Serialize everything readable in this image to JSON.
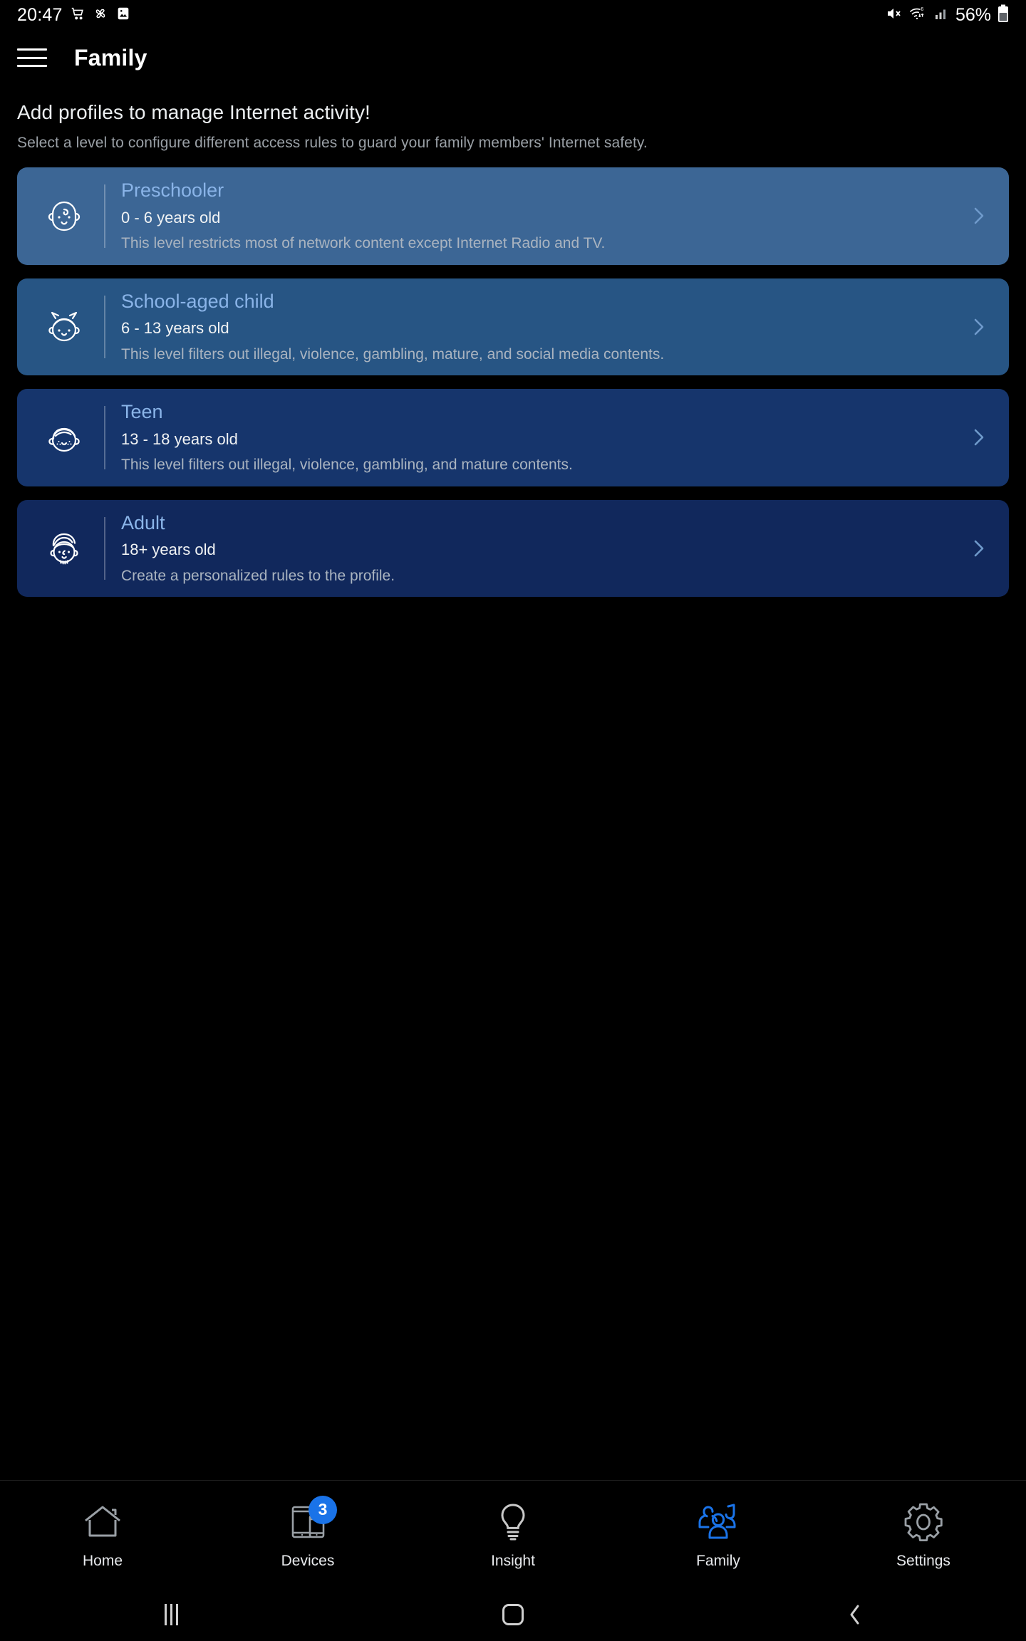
{
  "status_bar": {
    "time": "20:47",
    "left_icons": [
      "shopping-cart-icon",
      "pinwheel-icon",
      "image-icon"
    ],
    "right_icons": [
      "mute-icon",
      "wifi-6-icon",
      "cellular-signal-icon"
    ],
    "battery_percent": "56%"
  },
  "app_bar": {
    "menu_icon": "hamburger-menu-icon",
    "title": "Family"
  },
  "intro": {
    "title": "Add profiles to manage Internet activity!",
    "subtitle": "Select a level to configure different access rules to guard your family members' Internet safety."
  },
  "profiles": [
    {
      "name": "Preschooler",
      "age": "0 - 6 years old",
      "description": "This level restricts most of network content except Internet Radio and TV.",
      "avatar": "baby-face-icon",
      "bg": "#3c6695"
    },
    {
      "name": "School-aged child",
      "age": "6 - 13 years old",
      "description": "This level filters out illegal, violence, gambling, mature, and social media contents.",
      "avatar": "child-pigtails-face-icon",
      "bg": "#275584"
    },
    {
      "name": "Teen",
      "age": "13 - 18 years old",
      "description": "This level filters out illegal, violence, gambling, and mature contents.",
      "avatar": "teen-face-icon",
      "bg": "#16356c"
    },
    {
      "name": "Adult",
      "age": "18+ years old",
      "description": "Create a personalized rules to the profile.",
      "avatar": "adult-face-icon",
      "bg": "#11285c"
    }
  ],
  "bottom_nav": {
    "items": [
      {
        "label": "Home",
        "icon": "home-icon",
        "badge": "",
        "active": false
      },
      {
        "label": "Devices",
        "icon": "devices-icon",
        "badge": "3",
        "active": false
      },
      {
        "label": "Insight",
        "icon": "bulb-icon",
        "badge": "",
        "active": false
      },
      {
        "label": "Family",
        "icon": "family-icon",
        "badge": "",
        "active": true
      },
      {
        "label": "Settings",
        "icon": "gear-icon",
        "badge": "",
        "active": false
      }
    ],
    "active_color": "#1a73e8",
    "inactive_color": "#9aa0a6"
  },
  "android_nav": {
    "recents": "recents-icon",
    "home": "home-pill-icon",
    "back": "back-chevron-icon"
  },
  "colors": {
    "accent": "#1a73e8",
    "card_title": "#8ab4e8",
    "background": "#000000"
  }
}
